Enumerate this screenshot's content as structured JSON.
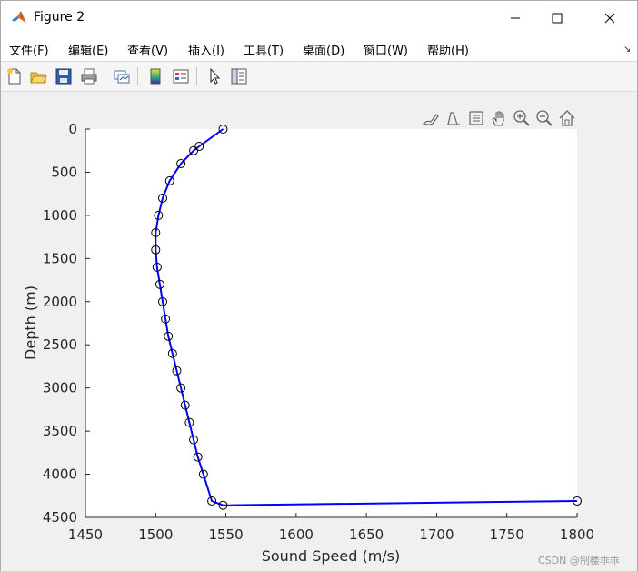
{
  "window": {
    "title": "Figure 2",
    "controls": [
      "minimize-icon",
      "maximize-icon",
      "close-icon"
    ]
  },
  "menubar": {
    "items": [
      {
        "label": "文件(F)",
        "name": "menu-file"
      },
      {
        "label": "编辑(E)",
        "name": "menu-edit"
      },
      {
        "label": "查看(V)",
        "name": "menu-view"
      },
      {
        "label": "插入(I)",
        "name": "menu-insert"
      },
      {
        "label": "工具(T)",
        "name": "menu-tools"
      },
      {
        "label": "桌面(D)",
        "name": "menu-desktop"
      },
      {
        "label": "窗口(W)",
        "name": "menu-window"
      },
      {
        "label": "帮助(H)",
        "name": "menu-help"
      }
    ]
  },
  "toolbar": {
    "icons": [
      "new-figure-icon",
      "open-file-icon",
      "save-icon",
      "print-icon",
      "link-plot-icon",
      "insert-colorbar-icon",
      "insert-legend-icon",
      "edit-plot-icon",
      "property-inspector-icon"
    ]
  },
  "axes_toolbar": {
    "icons": [
      "brush-icon",
      "data-tips-icon",
      "export-icon",
      "pan-icon",
      "zoom-in-icon",
      "zoom-out-icon",
      "home-icon"
    ]
  },
  "watermark": "CSDN @制楼乖乖",
  "colors": {
    "line": "#0000ff",
    "marker": "#000000",
    "axes_bg": "#ffffff",
    "figure_bg": "#f0f0f0"
  },
  "chart_data": {
    "type": "line",
    "title": "",
    "xlabel": "Sound Speed (m/s)",
    "ylabel": "Depth (m)",
    "xlim": [
      1450,
      1800
    ],
    "ylim": [
      0,
      4500
    ],
    "y_reversed": true,
    "x_ticks": [
      1450,
      1500,
      1550,
      1600,
      1650,
      1700,
      1750,
      1800
    ],
    "y_ticks": [
      0,
      500,
      1000,
      1500,
      2000,
      2500,
      3000,
      3500,
      4000,
      4500
    ],
    "grid": false,
    "series": [
      {
        "marker": "circle",
        "points": [
          [
            1548,
            0
          ],
          [
            1531,
            200
          ],
          [
            1527,
            250
          ],
          [
            1518,
            400
          ],
          [
            1510,
            600
          ],
          [
            1505,
            800
          ],
          [
            1502,
            1000
          ],
          [
            1500,
            1200
          ],
          [
            1500,
            1400
          ],
          [
            1501,
            1600
          ],
          [
            1503,
            1800
          ],
          [
            1505,
            2000
          ],
          [
            1507,
            2200
          ],
          [
            1509,
            2400
          ],
          [
            1512,
            2600
          ],
          [
            1515,
            2800
          ],
          [
            1518,
            3000
          ],
          [
            1521,
            3200
          ],
          [
            1524,
            3400
          ],
          [
            1527,
            3600
          ],
          [
            1530,
            3800
          ],
          [
            1534,
            4000
          ],
          [
            1540,
            4310
          ],
          [
            1548,
            4360
          ],
          [
            1800,
            4310
          ]
        ]
      }
    ]
  }
}
